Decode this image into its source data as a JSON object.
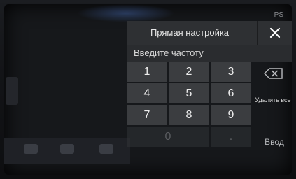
{
  "background": {
    "ps_label": "PS"
  },
  "dialog": {
    "title": "Прямая настройка",
    "prompt": "Введите частоту",
    "keys": {
      "k1": "1",
      "k2": "2",
      "k3": "3",
      "k4": "4",
      "k5": "5",
      "k6": "6",
      "k7": "7",
      "k8": "8",
      "k9": "9",
      "k0": "0",
      "dot": "."
    },
    "clear_all_label": "Удалить все",
    "enter_label": "Ввод",
    "icons": [
      "close-icon",
      "backspace-icon"
    ]
  },
  "colors": {
    "header_bg": "#2e3033",
    "key_bg": "#3b3d40",
    "text": "#e6e6e6"
  }
}
